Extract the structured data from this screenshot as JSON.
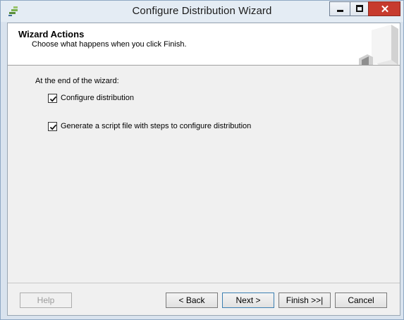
{
  "window": {
    "title": "Configure Distribution Wizard",
    "controls": {
      "minimize": "minimize",
      "maximize": "maximize",
      "close": "✕"
    }
  },
  "header": {
    "title": "Wizard Actions",
    "subtitle": "Choose what happens when you click Finish."
  },
  "actions": {
    "group_label": "At the end of the wizard:",
    "options": [
      {
        "label": "Configure distribution",
        "checked": true
      },
      {
        "label": "Generate a script file with steps to configure distribution",
        "checked": true
      }
    ]
  },
  "buttons": {
    "help": "Help",
    "back": "< Back",
    "next": "Next >",
    "finish": "Finish >>|",
    "cancel": "Cancel"
  },
  "colors": {
    "window_frame": "#d9e3ee",
    "close_button": "#c73b2e",
    "client_bg": "#f0f0f0"
  }
}
